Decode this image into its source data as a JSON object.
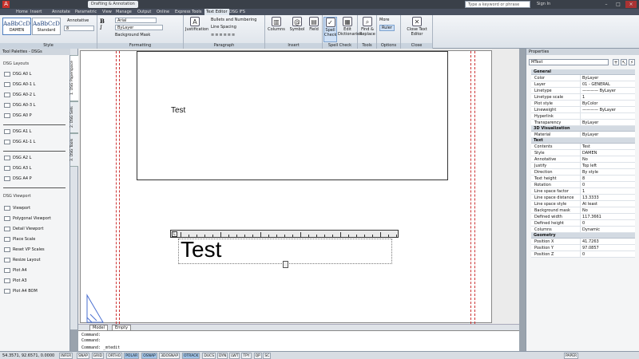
{
  "titlebar": {
    "title": "Drafting & Annotation",
    "search_placeholder": "Type a keyword or phrase",
    "signin": "Sign In"
  },
  "menu": [
    "Home",
    "Insert",
    "Annotate",
    "Parametric",
    "View",
    "Manage",
    "Output",
    "Online",
    "Express Tools",
    "Text Editor",
    "DSG IFS"
  ],
  "menu_active_index": 9,
  "ribbon": {
    "style": {
      "annotative_label": "Annotative",
      "height_value": "8",
      "group_label": "Style",
      "styles": [
        {
          "sample": "AaBbCcD",
          "name": "DAMEN"
        },
        {
          "sample": "AaBbCcD",
          "name": "Standard"
        }
      ]
    },
    "formatting": {
      "font": "Arial",
      "color": "ByLayer",
      "bg_mask": "Background Mask",
      "group_label": "Formatting"
    },
    "paragraph": {
      "justification": "Justification",
      "bullets": "Bullets and Numbering",
      "line_spacing": "Line Spacing",
      "group_label": "Paragraph"
    },
    "insert": {
      "columns": "Columns",
      "symbol": "Symbol",
      "field": "Field",
      "group_label": "Insert"
    },
    "spell": {
      "spell_check": "Spell Check",
      "edit_dict": "Edit Dictionaries",
      "group_label": "Spell Check"
    },
    "tools": {
      "find_replace": "Find & Replace",
      "group_label": "Tools"
    },
    "options": {
      "more": "More",
      "ruler": "Ruler",
      "group_label": "Options"
    },
    "close": {
      "close_editor": "Close Text Editor",
      "group_label": "Close"
    }
  },
  "palette": {
    "header": "Tool Palettes - DSGs",
    "tabs": [
      "1. DSG Paperspace",
      "2. DSG Sets",
      "3. DSG Tools"
    ],
    "layouts_title": "DSG Layouts",
    "layouts_a": [
      "DSG A0 L",
      "DSG A0-1 L",
      "DSG A0-2 L",
      "DSG A0-3 L",
      "DSG A0 P"
    ],
    "layouts_b": [
      "DSG A1 L",
      "DSG A1-1 L"
    ],
    "layouts_c": [
      "DSG A2 L",
      "DSG A3 L",
      "DSG A4 P"
    ],
    "viewport_title": "DSG Viewport",
    "viewport": [
      "Viewport",
      "Polygonal Viewport",
      "Detail Viewport",
      "Place Scale",
      "Reset VP Scales",
      "Resize Layout",
      "Plot A4",
      "Plot A3",
      "Plot A4 BOM"
    ]
  },
  "drawing": {
    "viewport_text": "Test",
    "edit_text": "Test",
    "ruler_label": "L"
  },
  "tabs": [
    "Model",
    "Empty"
  ],
  "command": [
    "Command:",
    "Command:",
    "Command: _mtedit"
  ],
  "properties": {
    "header": "Properties",
    "selection": "MText",
    "sections": [
      {
        "title": "General",
        "rows": [
          {
            "k": "Color",
            "v": "ByLayer"
          },
          {
            "k": "Layer",
            "v": "01 - GENERAL"
          },
          {
            "k": "Linetype",
            "v": "———— ByLayer"
          },
          {
            "k": "Linetype scale",
            "v": "1"
          },
          {
            "k": "Plot style",
            "v": "ByColor"
          },
          {
            "k": "Lineweight",
            "v": "———— ByLayer"
          },
          {
            "k": "Hyperlink",
            "v": ""
          },
          {
            "k": "Transparency",
            "v": "ByLayer"
          }
        ]
      },
      {
        "title": "3D Visualization",
        "rows": [
          {
            "k": "Material",
            "v": "ByLayer"
          }
        ]
      },
      {
        "title": "Text",
        "rows": [
          {
            "k": "Contents",
            "v": "Test"
          },
          {
            "k": "Style",
            "v": "DAMEN"
          },
          {
            "k": "Annotative",
            "v": "No"
          },
          {
            "k": "Justify",
            "v": "Top left"
          },
          {
            "k": "Direction",
            "v": "By style"
          },
          {
            "k": "Text height",
            "v": "8"
          },
          {
            "k": "Rotation",
            "v": "0"
          },
          {
            "k": "Line space factor",
            "v": "1"
          },
          {
            "k": "Line space distance",
            "v": "13.3333"
          },
          {
            "k": "Line space style",
            "v": "At least"
          },
          {
            "k": "Background mask",
            "v": "No"
          },
          {
            "k": "Defined width",
            "v": "117.3661"
          },
          {
            "k": "Defined height",
            "v": "0"
          },
          {
            "k": "Columns",
            "v": "Dynamic"
          }
        ]
      },
      {
        "title": "Geometry",
        "rows": [
          {
            "k": "Position X",
            "v": "41.7263"
          },
          {
            "k": "Position Y",
            "v": "97.0857"
          },
          {
            "k": "Position Z",
            "v": "0"
          }
        ]
      }
    ]
  },
  "status": {
    "coords": "54.3571, 92.6571, 0.0000",
    "toggles": [
      "INFER",
      "SNAP",
      "GRID",
      "ORTHO",
      "POLAR",
      "OSNAP",
      "3DOSNAP",
      "OTRACK",
      "DUCS",
      "DYN",
      "LWT",
      "TPY",
      "QP",
      "SC"
    ],
    "toggles_on": [
      "POLAR",
      "OSNAP",
      "OTRACK"
    ],
    "paper": "PAPER"
  }
}
